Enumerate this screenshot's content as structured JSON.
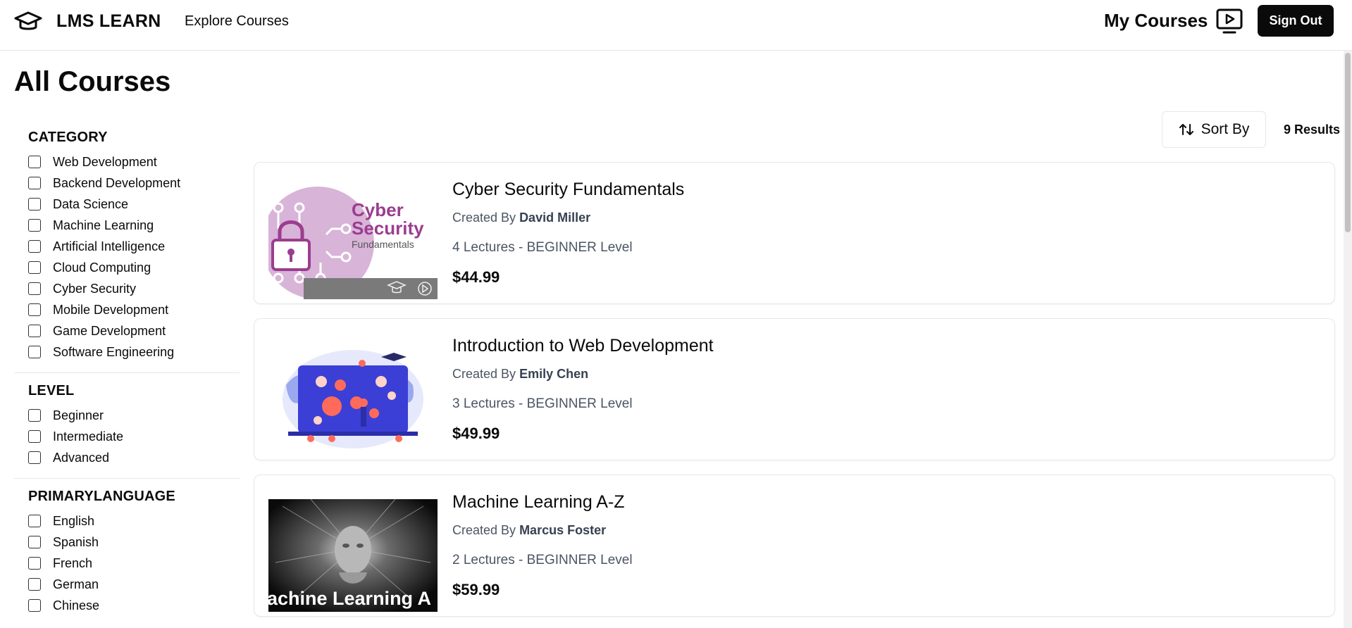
{
  "header": {
    "brand": "LMS LEARN",
    "explore_label": "Explore Courses",
    "my_courses_label": "My Courses",
    "sign_out_label": "Sign Out"
  },
  "page_title": "All Courses",
  "filters": {
    "category": {
      "title": "CATEGORY",
      "items": [
        "Web Development",
        "Backend Development",
        "Data Science",
        "Machine Learning",
        "Artificial Intelligence",
        "Cloud Computing",
        "Cyber Security",
        "Mobile Development",
        "Game Development",
        "Software Engineering"
      ]
    },
    "level": {
      "title": "LEVEL",
      "items": [
        "Beginner",
        "Intermediate",
        "Advanced"
      ]
    },
    "language": {
      "title": "PRIMARYLANGUAGE",
      "items": [
        "English",
        "Spanish",
        "French",
        "German",
        "Chinese"
      ]
    }
  },
  "toolbar": {
    "sort_label": "Sort By",
    "results_label": "9 Results"
  },
  "created_by_prefix": "Created By",
  "courses": [
    {
      "title": "Cyber Security Fundamentals",
      "instructor": "David Miller",
      "meta": "4 Lectures - BEGINNER Level",
      "price": "$44.99",
      "thumb_text": [
        "Cyber",
        "Security",
        "Fundamentals"
      ]
    },
    {
      "title": "Introduction to Web Development",
      "instructor": "Emily Chen",
      "meta": "3 Lectures - BEGINNER Level",
      "price": "$49.99"
    },
    {
      "title": "Machine Learning A-Z",
      "instructor": "Marcus Foster",
      "meta": "2 Lectures - BEGINNER Level",
      "price": "$59.99",
      "thumb_text": [
        "achine Learning A"
      ]
    }
  ],
  "colors": {
    "primary": "#0a0a0a",
    "muted_text": "#4b5563",
    "border": "#e5e7eb",
    "cyber_purple": "#9b3d8f",
    "web_blue": "#3b3fd6"
  }
}
